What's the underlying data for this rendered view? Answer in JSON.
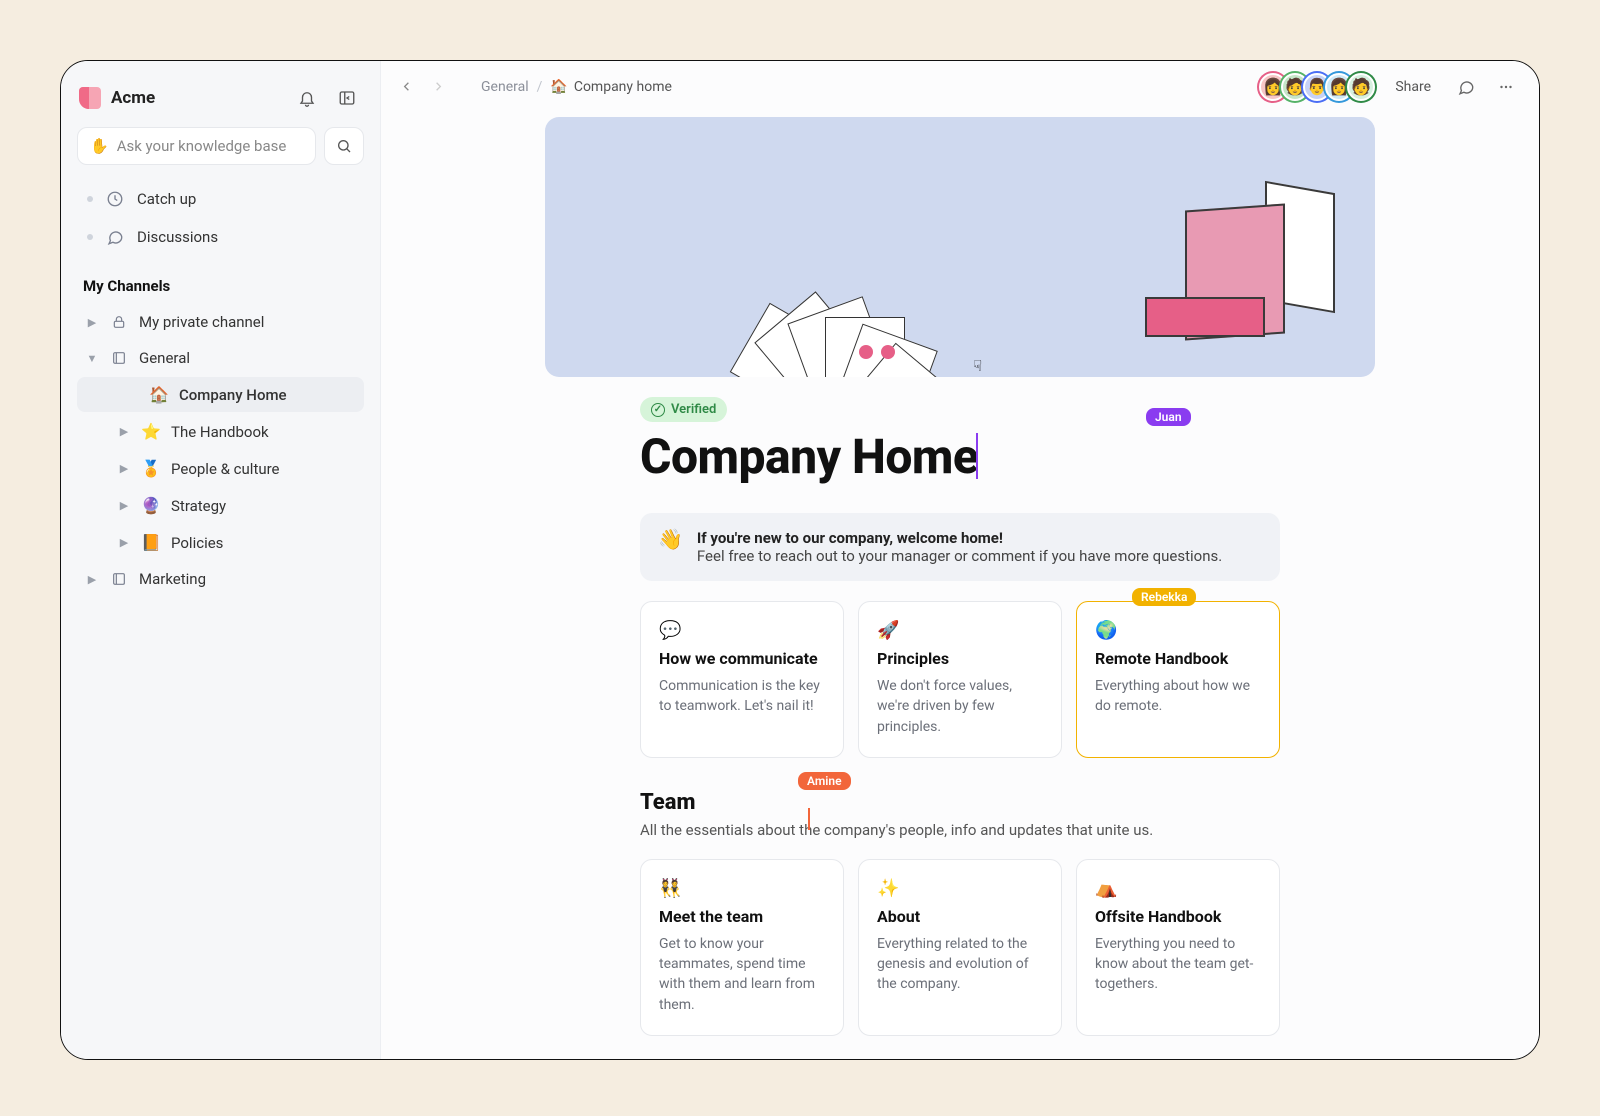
{
  "workspace": {
    "name": "Acme"
  },
  "search": {
    "placeholder": "Ask your knowledge base"
  },
  "nav": {
    "catch_up": "Catch up",
    "discussions": "Discussions"
  },
  "channels": {
    "heading": "My Channels",
    "private": "My private channel",
    "general": "General",
    "general_children": {
      "company_home": {
        "emoji": "🏠",
        "label": "Company Home"
      },
      "handbook": {
        "emoji": "⭐",
        "label": "The Handbook"
      },
      "people": {
        "emoji": "🏅",
        "label": "People & culture"
      },
      "strategy": {
        "emoji": "🔮",
        "label": "Strategy"
      },
      "policies": {
        "emoji": "📙",
        "label": "Policies"
      }
    },
    "marketing": "Marketing"
  },
  "breadcrumb": {
    "root": "General",
    "current": "Company home",
    "current_emoji": "🏠"
  },
  "topbar": {
    "share": "Share"
  },
  "presence_avatars": [
    {
      "bg": "#f7c6c6",
      "ring": "#e65f87",
      "glyph": "👩"
    },
    {
      "bg": "#c6e6c8",
      "ring": "#55b267",
      "glyph": "🧑"
    },
    {
      "bg": "#c7d2f7",
      "ring": "#4b6ef5",
      "glyph": "👨"
    },
    {
      "bg": "#cfeaf7",
      "ring": "#3498db",
      "glyph": "👩"
    },
    {
      "bg": "#d6f0df",
      "ring": "#2f8a46",
      "glyph": "🧑"
    }
  ],
  "cursors": {
    "juan": "Juan",
    "rebekka": "Rebekka",
    "amine": "Amine"
  },
  "page": {
    "verified": "Verified",
    "title": "Company Home",
    "callout": {
      "emoji": "👋",
      "title": "If you're new to our company, welcome home!",
      "body": "Feel free to reach out to your manager or comment if you have more questions."
    },
    "cards_top": [
      {
        "icon": "💬",
        "title": "How we communicate",
        "desc": "Communication is the key to teamwork. Let's nail it!"
      },
      {
        "icon": "🚀",
        "title": "Principles",
        "desc": "We don't force values, we're driven by few principles."
      },
      {
        "icon": "🌍",
        "title": "Remote Handbook",
        "desc": "Everything about how we do remote."
      }
    ],
    "team_section": {
      "heading": "Team",
      "sub": "All the essentials about the company's people, info and updates that unite us."
    },
    "cards_team": [
      {
        "icon": "👯",
        "title": "Meet the team",
        "desc": "Get to know your teammates, spend time with them and learn from them."
      },
      {
        "icon": "✨",
        "title": "About",
        "desc": "Everything related to the genesis and evolution of the company."
      },
      {
        "icon": "⛺",
        "title": "Offsite Handbook",
        "desc": "Everything you need to know about the team get-togethers."
      }
    ]
  }
}
